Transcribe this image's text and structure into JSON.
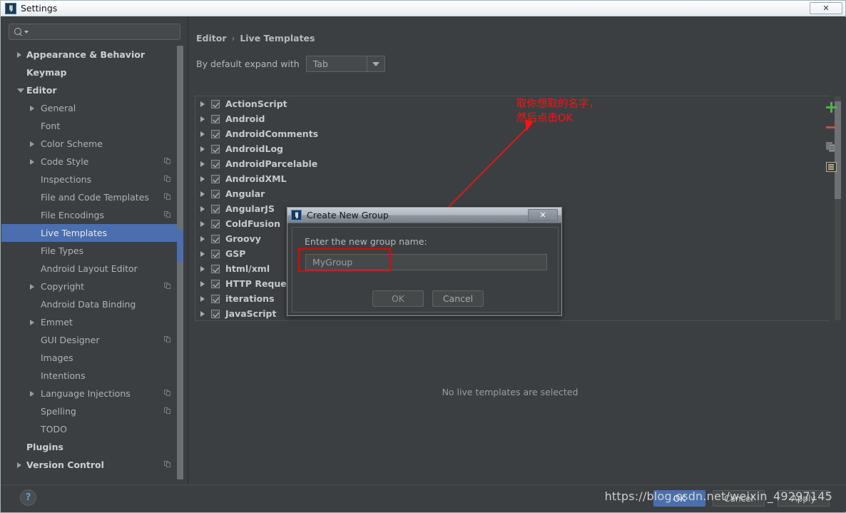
{
  "window": {
    "title": "Settings",
    "app_icon": "intellij-idea-icon",
    "close_label": "✕"
  },
  "search": {
    "value": "",
    "placeholder": "",
    "icon": "search-icon"
  },
  "sidebar": {
    "items": [
      {
        "label": "Appearance & Behavior",
        "level": 0,
        "arrow": "right",
        "bold": true,
        "copy": false,
        "selected": false
      },
      {
        "label": "Keymap",
        "level": 0,
        "arrow": "none",
        "bold": true,
        "copy": false,
        "selected": false
      },
      {
        "label": "Editor",
        "level": 0,
        "arrow": "down",
        "bold": true,
        "copy": false,
        "selected": false
      },
      {
        "label": "General",
        "level": 1,
        "arrow": "right",
        "bold": false,
        "copy": false,
        "selected": false
      },
      {
        "label": "Font",
        "level": 1,
        "arrow": "none",
        "bold": false,
        "copy": false,
        "selected": false
      },
      {
        "label": "Color Scheme",
        "level": 1,
        "arrow": "right",
        "bold": false,
        "copy": false,
        "selected": false
      },
      {
        "label": "Code Style",
        "level": 1,
        "arrow": "right",
        "bold": false,
        "copy": true,
        "selected": false
      },
      {
        "label": "Inspections",
        "level": 1,
        "arrow": "none",
        "bold": false,
        "copy": true,
        "selected": false
      },
      {
        "label": "File and Code Templates",
        "level": 1,
        "arrow": "none",
        "bold": false,
        "copy": true,
        "selected": false
      },
      {
        "label": "File Encodings",
        "level": 1,
        "arrow": "none",
        "bold": false,
        "copy": true,
        "selected": false
      },
      {
        "label": "Live Templates",
        "level": 1,
        "arrow": "none",
        "bold": false,
        "copy": false,
        "selected": true
      },
      {
        "label": "File Types",
        "level": 1,
        "arrow": "none",
        "bold": false,
        "copy": false,
        "selected": false
      },
      {
        "label": "Android Layout Editor",
        "level": 1,
        "arrow": "none",
        "bold": false,
        "copy": false,
        "selected": false
      },
      {
        "label": "Copyright",
        "level": 1,
        "arrow": "right",
        "bold": false,
        "copy": true,
        "selected": false
      },
      {
        "label": "Android Data Binding",
        "level": 1,
        "arrow": "none",
        "bold": false,
        "copy": false,
        "selected": false
      },
      {
        "label": "Emmet",
        "level": 1,
        "arrow": "right",
        "bold": false,
        "copy": false,
        "selected": false
      },
      {
        "label": "GUI Designer",
        "level": 1,
        "arrow": "none",
        "bold": false,
        "copy": true,
        "selected": false
      },
      {
        "label": "Images",
        "level": 1,
        "arrow": "none",
        "bold": false,
        "copy": false,
        "selected": false
      },
      {
        "label": "Intentions",
        "level": 1,
        "arrow": "none",
        "bold": false,
        "copy": false,
        "selected": false
      },
      {
        "label": "Language Injections",
        "level": 1,
        "arrow": "right",
        "bold": false,
        "copy": true,
        "selected": false
      },
      {
        "label": "Spelling",
        "level": 1,
        "arrow": "none",
        "bold": false,
        "copy": true,
        "selected": false
      },
      {
        "label": "TODO",
        "level": 1,
        "arrow": "none",
        "bold": false,
        "copy": false,
        "selected": false
      },
      {
        "label": "Plugins",
        "level": 0,
        "arrow": "none",
        "bold": true,
        "copy": false,
        "selected": false
      },
      {
        "label": "Version Control",
        "level": 0,
        "arrow": "right",
        "bold": true,
        "copy": true,
        "selected": false
      }
    ]
  },
  "breadcrumb": {
    "root": "Editor",
    "separator": "›",
    "leaf": "Live Templates"
  },
  "expand": {
    "label": "By default expand with",
    "value": "Tab",
    "dropdown_icon": "chevron-down-icon"
  },
  "templates": {
    "groups": [
      {
        "name": "ActionScript",
        "checked": true
      },
      {
        "name": "Android",
        "checked": true
      },
      {
        "name": "AndroidComments",
        "checked": true
      },
      {
        "name": "AndroidLog",
        "checked": true
      },
      {
        "name": "AndroidParcelable",
        "checked": true
      },
      {
        "name": "AndroidXML",
        "checked": true
      },
      {
        "name": "Angular",
        "checked": true
      },
      {
        "name": "AngularJS",
        "checked": true
      },
      {
        "name": "ColdFusion",
        "checked": true
      },
      {
        "name": "Groovy",
        "checked": true
      },
      {
        "name": "GSP",
        "checked": true
      },
      {
        "name": "html/xml",
        "checked": true
      },
      {
        "name": "HTTP Request",
        "checked": true
      },
      {
        "name": "iterations",
        "checked": true
      },
      {
        "name": "JavaScript",
        "checked": true
      }
    ],
    "empty_message": "No live templates are selected"
  },
  "toolbar": {
    "add_icon": "plus-icon",
    "remove_icon": "minus-icon",
    "duplicate_icon": "copy-icon",
    "edit_icon": "document-icon"
  },
  "dialog": {
    "title": "Create New Group",
    "icon": "intellij-idea-icon",
    "close_label": "✕",
    "prompt": "Enter the new group name:",
    "input_value": "MyGroup",
    "ok_label": "OK",
    "cancel_label": "Cancel"
  },
  "bottom": {
    "help_label": "?",
    "ok_label": "OK",
    "cancel_label": "Cancel",
    "apply_label": "Apply"
  },
  "annotation": {
    "line1": "取你想取的名字，",
    "line2": "然后点击OK",
    "color": "#ff1111"
  },
  "watermark": {
    "text": "https://blog.csdn.net/weixin_49297145"
  },
  "colors": {
    "background": "#3c3f41",
    "selection": "#4b6eaf",
    "accent_green": "#4fb04f",
    "accent_red": "#c0504d",
    "annotation_red": "#ff1111"
  }
}
